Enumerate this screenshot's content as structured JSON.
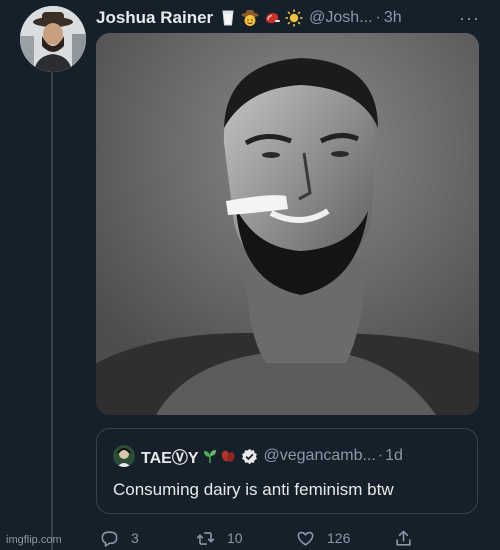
{
  "tweet": {
    "display_name": "Joshua Rainer",
    "name_emojis": [
      "milk-glass-icon",
      "cowboy-face-icon",
      "meat-icon",
      "sun-icon"
    ],
    "handle": "@Josh...",
    "separator": "·",
    "time": "3h",
    "more_label": "···"
  },
  "quote": {
    "display_name": "TAEⓋY",
    "name_emojis": [
      "seedling-icon",
      "beans-icon"
    ],
    "verified": true,
    "handle": "@vegancamb...",
    "separator": "·",
    "time": "1d",
    "text": "Consuming dairy is anti feminism btw"
  },
  "actions": {
    "replies": "3",
    "retweets": "10",
    "likes": "126"
  },
  "watermark": "imgflip.com",
  "colors": {
    "background": "#15202b",
    "text": "#e7e9ea",
    "muted": "#8b98a5",
    "border": "#38444d",
    "verified": "#e7e9ea"
  }
}
